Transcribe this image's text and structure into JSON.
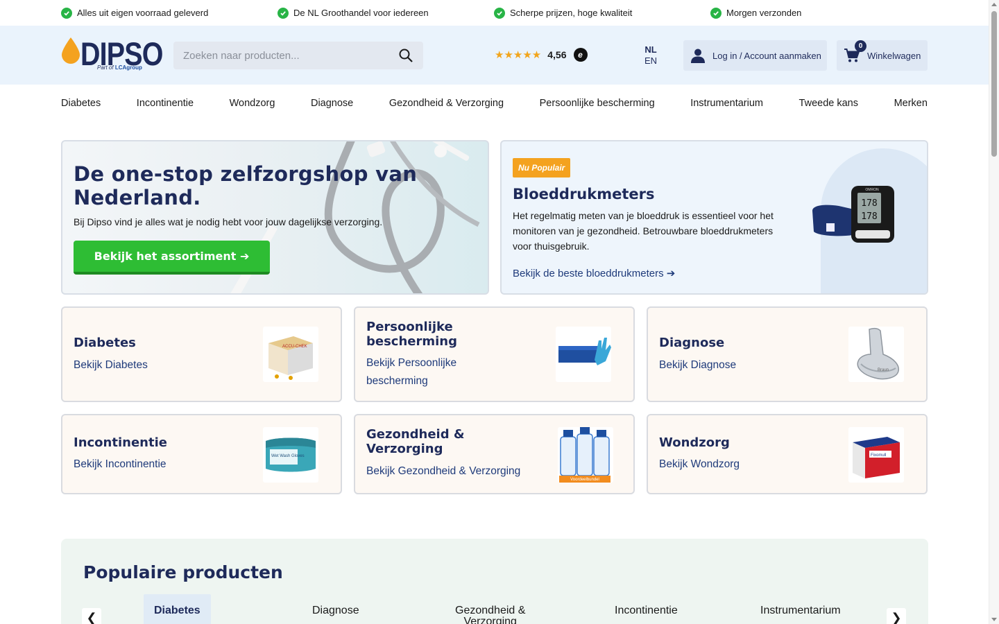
{
  "usp": [
    "Alles uit eigen voorraad geleverd",
    "De NL Groothandel voor iedereen",
    "Scherpe prijzen, hoge kwaliteit",
    "Morgen verzonden"
  ],
  "header": {
    "logo_text": "DIPSO",
    "logo_sub_prefix": "Part of",
    "logo_sub_brand": "LCAgroup",
    "search_placeholder": "Zoeken naar producten...",
    "rating_stars": "★★★★★",
    "rating_value": "4,56",
    "rating_badge": "e",
    "lang_active": "NL",
    "lang_other": "EN",
    "login_label": "Log in / Account aanmaken",
    "cart_label": "Winkelwagen",
    "cart_count": "0"
  },
  "nav": [
    "Diabetes",
    "Incontinentie",
    "Wondzorg",
    "Diagnose",
    "Gezondheid & Verzorging",
    "Persoonlijke bescherming",
    "Instrumentarium",
    "Tweede kans",
    "Merken"
  ],
  "hero": {
    "title_line1": "De one-stop zelfzorgshop van",
    "title_line2": "Nederland.",
    "subtitle": "Bij Dipso vind je alles wat je nodig hebt voor jouw dagelijkse verzorging.",
    "button": "Bekijk het assortiment ➔"
  },
  "promo": {
    "badge": "Nu Populair",
    "title": "Bloeddrukmeters",
    "text": "Het regelmatig meten van je bloeddruk is essentieel voor het monitoren van je gezondheid. Betrouwbare bloeddrukmeters voor thuisgebruik.",
    "link": "Bekijk de beste bloeddrukmeters ➔",
    "device_brand": "OMRON",
    "device_reading1": "178",
    "device_reading2": "178"
  },
  "categories": [
    {
      "title1": "Diabetes",
      "title2": "",
      "link1": "Bekijk Diabetes",
      "link2": "",
      "image_label": "ACCU-CHEK"
    },
    {
      "title1": "Persoonlijke",
      "title2": "bescherming",
      "link1": "Bekijk Persoonlijke",
      "link2": "bescherming",
      "image_label": ""
    },
    {
      "title1": "Diagnose",
      "title2": "",
      "link1": "Bekijk Diagnose",
      "link2": "",
      "image_label": "Braun"
    },
    {
      "title1": "Incontinentie",
      "title2": "",
      "link1": "Bekijk Incontinentie",
      "link2": "",
      "image_label": "Wet Wash Gloves"
    },
    {
      "title1": "Gezondheid &",
      "title2": "Verzorging",
      "link1": "Bekijk Gezondheid & Verzorging",
      "link2": "",
      "image_label": "Voordeelbundel"
    },
    {
      "title1": "Wondzorg",
      "title2": "",
      "link1": "Bekijk Wondzorg",
      "link2": "",
      "image_label": "Fixomull"
    }
  ],
  "popular": {
    "title": "Populaire producten",
    "tabs": [
      "Diabetes",
      "Diagnose",
      "Gezondheid &",
      "Verzorging",
      "Incontinentie",
      "Instrumentarium"
    ],
    "prev": "❮",
    "next": "❯"
  },
  "colors": {
    "brand_navy": "#1e2a5a",
    "brand_orange": "#f4a21f",
    "cta_green": "#2ebd34",
    "header_bg": "#eaf3fc"
  }
}
